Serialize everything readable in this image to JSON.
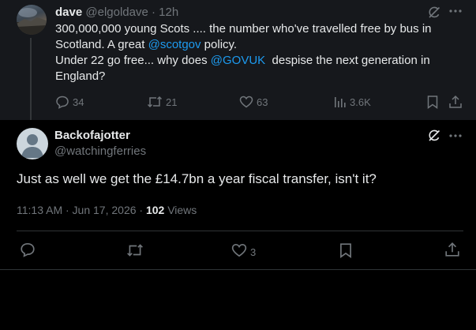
{
  "parent_tweet": {
    "display_name": "dave",
    "handle": "@elgoldave",
    "separator": "·",
    "time": "12h",
    "text_lines": [
      "300,000,000 young Scots .... the number who've travelled free by bus in",
      "Scotland. A great ",
      "@scotgov",
      " policy.",
      "Under 22 go free... why does ",
      "@GOVUK",
      "  despise the next generation in",
      "England?"
    ],
    "replies": "34",
    "reposts": "21",
    "likes": "63",
    "views": "3.6K"
  },
  "main_tweet": {
    "display_name": "Backofajotter",
    "handle": "@watchingferries",
    "text": "Just as well we get the £14.7bn a year fiscal transfer, isn't it?",
    "timestamp": "11:13 AM · Jun 17, 2026 · ",
    "views_count": "102",
    "views_label": " Views",
    "likes": "3"
  },
  "icons": {
    "more": "more-icon",
    "grok": "grok-icon",
    "reply": "reply-icon",
    "repost": "repost-icon",
    "like": "like-icon",
    "views": "views-icon",
    "bookmark": "bookmark-icon",
    "share": "share-icon"
  },
  "colors": {
    "background": "#000000",
    "parent_background": "#16181c",
    "text": "#e7e9ea",
    "muted": "#71767b",
    "link": "#1d9bf0",
    "divider": "#2f3336"
  }
}
